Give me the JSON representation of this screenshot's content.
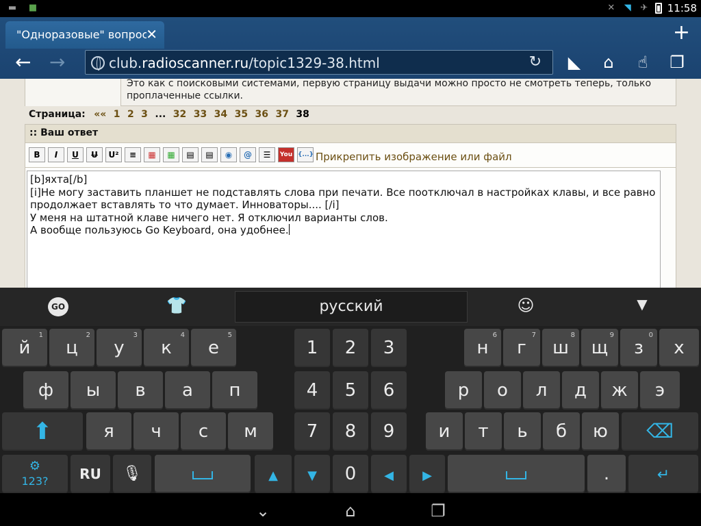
{
  "status_bar": {
    "time": "11:58",
    "left_icons": [
      "keyboard-icon",
      "app-icon"
    ],
    "right_icons": [
      "mute-icon",
      "wifi-icon",
      "airplane-icon",
      "battery-icon"
    ]
  },
  "browser": {
    "tab_title": "\"Одноразовые\" вопрос...",
    "url_prefix": "club.",
    "url_domain": "radioscanner.ru",
    "url_path": "/topic1329-38.html"
  },
  "page": {
    "prev_post_text": "Это как с поисковыми системами, первую страницу выдачи можно просто не смотреть теперь, только проплаченные ссылки.",
    "pager_label": "Страница:",
    "pager_links": [
      "««",
      "1",
      "2",
      "3",
      "...",
      "32",
      "33",
      "34",
      "35",
      "36",
      "37"
    ],
    "pager_current": "38",
    "reply_header": ":: Ваш ответ",
    "toolbar_buttons": [
      "B",
      "I",
      "U",
      "U",
      "U²",
      "≡",
      "▦",
      "▦",
      "▤",
      "▤",
      "◉",
      "@",
      "☰",
      "You",
      "{...}"
    ],
    "attach_link": "Прикрепить изображение или файл",
    "editor_lines": [
      "[b]яхта[/b]",
      "[i]Не могу заставить планшет не подставлять слова при печати. Все поотключал в настройках клавы, и все равно продолжает вставлять то что думает. Инноваторы.... [/i]",
      "У меня на штатной клаве ничего нет. Я отключил варианты слов.",
      "А вообще пользуюсь Go Keyboard, она удобнее."
    ]
  },
  "keyboard": {
    "language": "русский",
    "go_label": "GO",
    "row1_letters": [
      {
        "k": "й",
        "n": "1"
      },
      {
        "k": "ц",
        "n": "2"
      },
      {
        "k": "у",
        "n": "3"
      },
      {
        "k": "к",
        "n": "4"
      },
      {
        "k": "е",
        "n": "5"
      }
    ],
    "row1_right": [
      {
        "k": "н",
        "n": "6"
      },
      {
        "k": "г",
        "n": "7"
      },
      {
        "k": "ш",
        "n": "8"
      },
      {
        "k": "щ",
        "n": "9"
      },
      {
        "k": "з",
        "n": "0"
      },
      {
        "k": "х",
        "n": ""
      }
    ],
    "row2_left": [
      "ф",
      "ы",
      "в",
      "а",
      "п"
    ],
    "row2_right": [
      "р",
      "о",
      "л",
      "д",
      "ж",
      "э"
    ],
    "row3_left": [
      "я",
      "ч",
      "с",
      "м"
    ],
    "row3_right": [
      "и",
      "т",
      "ь",
      "б",
      "ю"
    ],
    "numpad": [
      "1",
      "2",
      "3",
      "4",
      "5",
      "6",
      "7",
      "8",
      "9"
    ],
    "zero": "0",
    "lang_key": "RU",
    "symbols_key": "123?",
    "period_key": "."
  }
}
